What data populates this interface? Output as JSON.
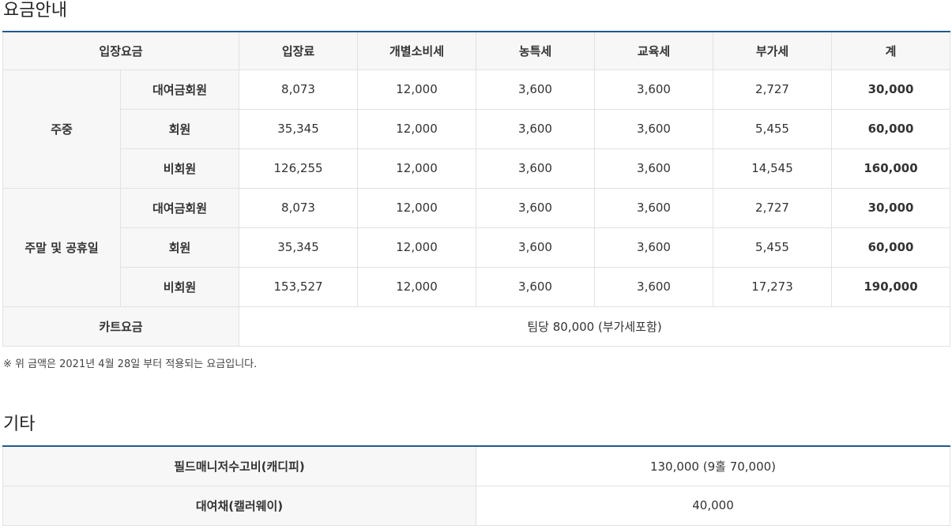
{
  "fees": {
    "title": "요금안내",
    "headers": [
      "입장요금",
      "입장료",
      "개별소비세",
      "농특세",
      "교육세",
      "부가세",
      "계"
    ],
    "groups": [
      {
        "name": "주중",
        "rows": [
          {
            "type": "대여금회원",
            "cells": [
              "8,073",
              "12,000",
              "3,600",
              "3,600",
              "2,727",
              "30,000"
            ]
          },
          {
            "type": "회원",
            "cells": [
              "35,345",
              "12,000",
              "3,600",
              "3,600",
              "5,455",
              "60,000"
            ]
          },
          {
            "type": "비회원",
            "cells": [
              "126,255",
              "12,000",
              "3,600",
              "3,600",
              "14,545",
              "160,000"
            ]
          }
        ]
      },
      {
        "name": "주말 및 공휴일",
        "rows": [
          {
            "type": "대여금회원",
            "cells": [
              "8,073",
              "12,000",
              "3,600",
              "3,600",
              "2,727",
              "30,000"
            ]
          },
          {
            "type": "회원",
            "cells": [
              "35,345",
              "12,000",
              "3,600",
              "3,600",
              "5,455",
              "60,000"
            ]
          },
          {
            "type": "비회원",
            "cells": [
              "153,527",
              "12,000",
              "3,600",
              "3,600",
              "17,273",
              "190,000"
            ]
          }
        ]
      }
    ],
    "cart": {
      "label": "카트요금",
      "value": "팀당 80,000 (부가세포함)"
    },
    "note": "※ 위 금액은 2021년 4월 28일 부터 적용되는 요금입니다."
  },
  "etc": {
    "title": "기타",
    "rows": [
      {
        "label": "필드매니저수고비(캐디피)",
        "value": "130,000 (9홀 70,000)"
      },
      {
        "label": "대여채(캘러웨이)",
        "value": "40,000"
      }
    ]
  }
}
